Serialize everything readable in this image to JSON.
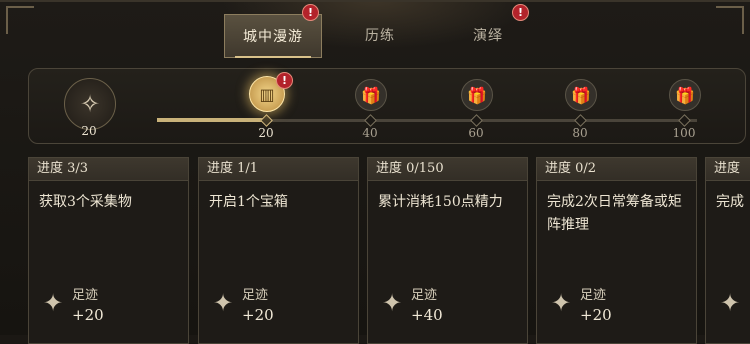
{
  "tabs": [
    {
      "label": "城中漫游",
      "active": true,
      "alert": "!"
    },
    {
      "label": "历练",
      "active": false,
      "alert": ""
    },
    {
      "label": "演绎",
      "active": false,
      "alert": "!"
    }
  ],
  "progress": {
    "current_points": "20",
    "current": 20,
    "max": 100,
    "emblem_icon": "footprint-emblem-icon",
    "milestones": [
      {
        "label": "20",
        "icon": "glowing-chest-icon",
        "reached": true,
        "alert": "!"
      },
      {
        "label": "40",
        "icon": "gift-box-icon",
        "reached": false,
        "alert": ""
      },
      {
        "label": "60",
        "icon": "gift-box-icon",
        "reached": false,
        "alert": ""
      },
      {
        "label": "80",
        "icon": "gift-box-icon",
        "reached": false,
        "alert": ""
      },
      {
        "label": "100",
        "icon": "gift-box-icon",
        "reached": false,
        "alert": ""
      }
    ],
    "colors": {
      "fill": "#c9b27a",
      "track": "#4a443a",
      "glow": "#f2d58a"
    }
  },
  "tasks": [
    {
      "progress": "进度 3/3",
      "title": "获取3个采集物",
      "reward_name": "足迹",
      "reward_amount": "+20",
      "icon": "footprint-icon"
    },
    {
      "progress": "进度 1/1",
      "title": "开启1个宝箱",
      "reward_name": "足迹",
      "reward_amount": "+20",
      "icon": "footprint-icon"
    },
    {
      "progress": "进度 0/150",
      "title": "累计消耗150点精力",
      "reward_name": "足迹",
      "reward_amount": "+40",
      "icon": "footprint-icon"
    },
    {
      "progress": "进度 0/2",
      "title": "完成2次日常筹备或矩阵推理",
      "reward_name": "足迹",
      "reward_amount": "+20",
      "icon": "footprint-icon"
    },
    {
      "progress": "进度",
      "title": "完成",
      "reward_name": "",
      "reward_amount": "",
      "icon": "footprint-icon"
    }
  ]
}
